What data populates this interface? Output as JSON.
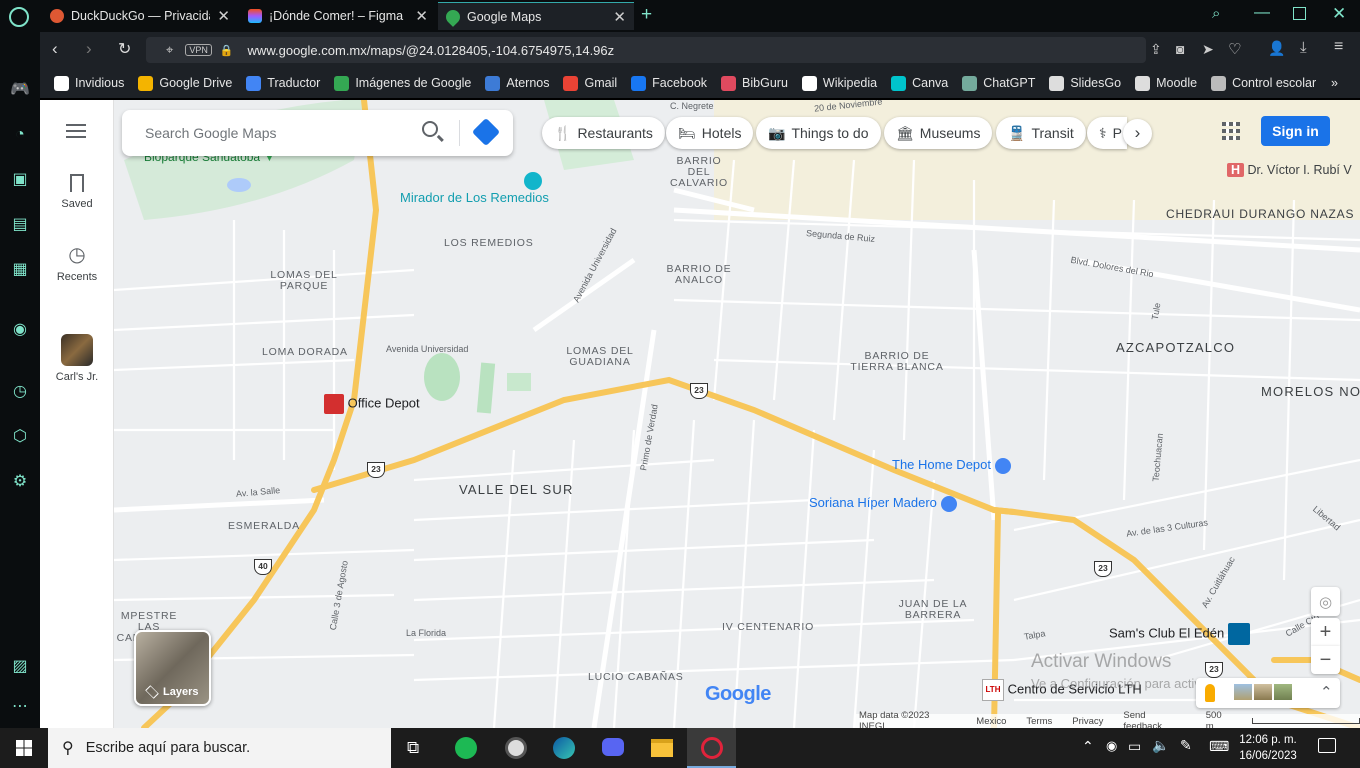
{
  "browser": {
    "tabs": [
      {
        "title": "DuckDuckGo — Privacidad",
        "icon": "duckduckgo-icon",
        "active": false
      },
      {
        "title": "¡Dónde Comer! – Figma",
        "icon": "figma-icon",
        "active": false
      },
      {
        "title": "Google Maps",
        "icon": "google-maps-icon",
        "active": true
      }
    ],
    "vpn_label": "VPN",
    "url": "www.google.com.mx/maps/@24.0128405,-104.6754975,14.96z",
    "bookmarks": [
      {
        "label": "Invidious",
        "color": "#ffffff"
      },
      {
        "label": "Google Drive",
        "color": "#f4b400"
      },
      {
        "label": "Traductor",
        "color": "#4285f4"
      },
      {
        "label": "Imágenes de Google",
        "color": "#34a853"
      },
      {
        "label": "Aternos",
        "color": "#3d7bd6"
      },
      {
        "label": "Gmail",
        "color": "#ea4335"
      },
      {
        "label": "Facebook",
        "color": "#1877f2"
      },
      {
        "label": "BibGuru",
        "color": "#e04a5f"
      },
      {
        "label": "Wikipedia",
        "color": "#ffffff"
      },
      {
        "label": "Canva",
        "color": "#00c4cc"
      },
      {
        "label": "ChatGPT",
        "color": "#74aa9c"
      },
      {
        "label": "SlidesGo",
        "color": "#dddddd"
      },
      {
        "label": "Moodle",
        "color": "#dddddd"
      },
      {
        "label": "Control escolar",
        "color": "#bbbbbb"
      }
    ],
    "more_bookmarks": "»"
  },
  "maps": {
    "search_placeholder": "Search Google Maps",
    "rail": {
      "saved": "Saved",
      "recents": "Recents",
      "place": "Carl's Jr."
    },
    "chips": [
      {
        "label": "Restaurants",
        "icon": "fork-knife-icon"
      },
      {
        "label": "Hotels",
        "icon": "bed-icon"
      },
      {
        "label": "Things to do",
        "icon": "camera-icon"
      },
      {
        "label": "Museums",
        "icon": "museum-icon"
      },
      {
        "label": "Transit",
        "icon": "train-icon"
      },
      {
        "label": "P",
        "icon": "pharmacy-icon"
      }
    ],
    "signin": "Sign in",
    "layers": "Layers",
    "watermark": "Activar Windows",
    "watermark_sub": "Ve a Configuración para activar Windows.",
    "map_labels": {
      "biop": "Bioparque Sahuatoba",
      "mirador": "Mirador de Los Remedios",
      "los_remedios": "LOS REMEDIOS",
      "lomas_parque": "LOMAS DEL PARQUE",
      "loma_dorada": "LOMA DORADA",
      "barrio_calvario": "BARRIO DEL CALVARIO",
      "barrio_analco": "BARRIO DE ANALCO",
      "lomas_guadiana": "LOMAS DEL GUADIANA",
      "barrio_tierra": "BARRIO DE TIERRA BLANCA",
      "azcapotzalco": "AZCAPOTZALCO",
      "morelos": "MORELOS NOR",
      "valle_sur": "VALLE DEL SUR",
      "esmeralda": "ESMERALDA",
      "campestre": "MPESTRE LAS CARANDAS",
      "juan_barrera": "JUAN DE LA BARRERA",
      "iv_centenario": "IV CENTENARIO",
      "lucio": "LUCIO CABAÑAS",
      "chedraui": "CHEDRAUI DURANGO NAZAS",
      "dr_victor": "Dr. Víctor I. Rubí V",
      "office_depot": "Office Depot",
      "home_depot": "The Home Depot",
      "soriana": "Soriana Híper Madero",
      "sams": "Sam's Club El Edén",
      "lth": "Centro de Servicio LTH",
      "av_universidad": "Avenida Universidad",
      "av_universidad2": "Avenida Universidad",
      "segunda_ruiz": "Segunda de Ruiz",
      "dolores": "Blvd. Dolores del Rio",
      "av_salle": "Av. la Salle",
      "la_florida": "La Florida",
      "tres_culturas": "Av. de las 3 Culturas",
      "primo_verdad": "Primo de Verdad",
      "calle_agosto": "Calle 3 de Agosto",
      "cuitlahuac": "Av. Cuitláhuac",
      "tule": "Tule",
      "talpa": "Talpa",
      "libertad": "Libertad",
      "noviembre": "20 de Noviembre",
      "negrete": "C. Negrete",
      "texcoco": "Teochuacan",
      "calle_cto": "Calle Cto"
    },
    "shields": [
      "23",
      "23",
      "23",
      "23",
      "40",
      "23"
    ],
    "footer": [
      "Map data ©2023 INEGI",
      "Mexico",
      "Terms",
      "Privacy",
      "Send feedback",
      "500 m"
    ],
    "google_logo": "Google"
  },
  "taskbar": {
    "search_placeholder": "Escribe aquí para buscar.",
    "time": "12:06 p. m.",
    "date": "16/06/2023"
  }
}
